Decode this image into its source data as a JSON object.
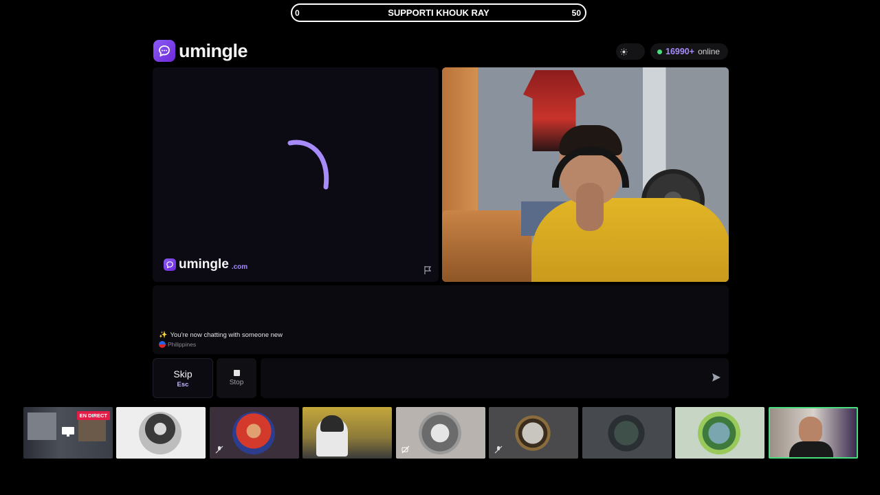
{
  "banner": {
    "left_value": "0",
    "title": "SUPPORTI KHOUK RAY",
    "right_value": "50"
  },
  "header": {
    "brand": "umingle",
    "online_count": "16990+",
    "online_label": "online"
  },
  "left_pane": {
    "watermark_brand": "umingle",
    "watermark_domain": ".com",
    "state": "loading"
  },
  "chat": {
    "system_message": "You're now chatting with someone new",
    "country": "Philippines"
  },
  "controls": {
    "skip_label": "Skip",
    "skip_key": "Esc",
    "stop_label": "Stop",
    "message_placeholder": ""
  },
  "thumbnails": {
    "live_badge": "EN DIRECT"
  },
  "colors": {
    "accent": "#8b5cf6",
    "online_dot": "#4ade80",
    "live": "#e11d48"
  }
}
